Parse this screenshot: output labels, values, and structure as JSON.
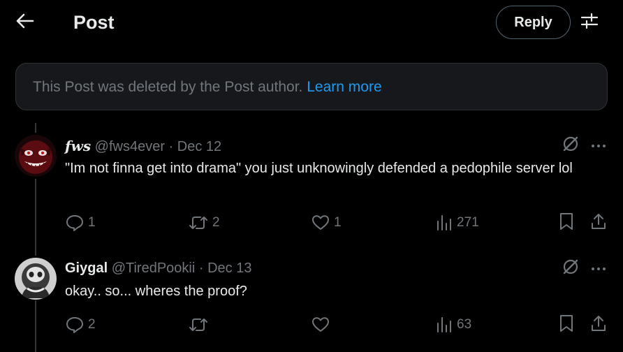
{
  "header": {
    "title": "Post",
    "reply_label": "Reply"
  },
  "notice": {
    "text": "This Post was deleted by the Post author.",
    "link": "Learn more"
  },
  "posts": [
    {
      "display_name": "fws",
      "handle_meta": "@fws4ever · Dec 12",
      "body": "\"Im not finna get into drama\" you just unknowingly defended a pedophile server lol",
      "replies": "1",
      "reposts": "2",
      "likes": "1",
      "views": "271"
    },
    {
      "display_name": "Giygal",
      "handle_meta": "@TiredPookii · Dec 13",
      "body": "okay.. so... wheres the proof?",
      "replies": "2",
      "reposts": "",
      "likes": "",
      "views": "63"
    }
  ],
  "icons": {
    "back": "arrow-left-icon",
    "adjust": "sliders-icon",
    "grok": "slash-circle-icon",
    "more": "more-dots-icon",
    "reply": "speech-bubble-icon",
    "repost": "repost-icon",
    "like": "heart-icon",
    "views": "bar-chart-icon",
    "bookmark": "bookmark-icon",
    "share": "share-icon"
  },
  "colors": {
    "background": "#000000",
    "text": "#e7e9ea",
    "muted": "#71767b",
    "accent": "#1d9bf0",
    "notice_bg": "#16181c",
    "border": "#2f3336"
  }
}
